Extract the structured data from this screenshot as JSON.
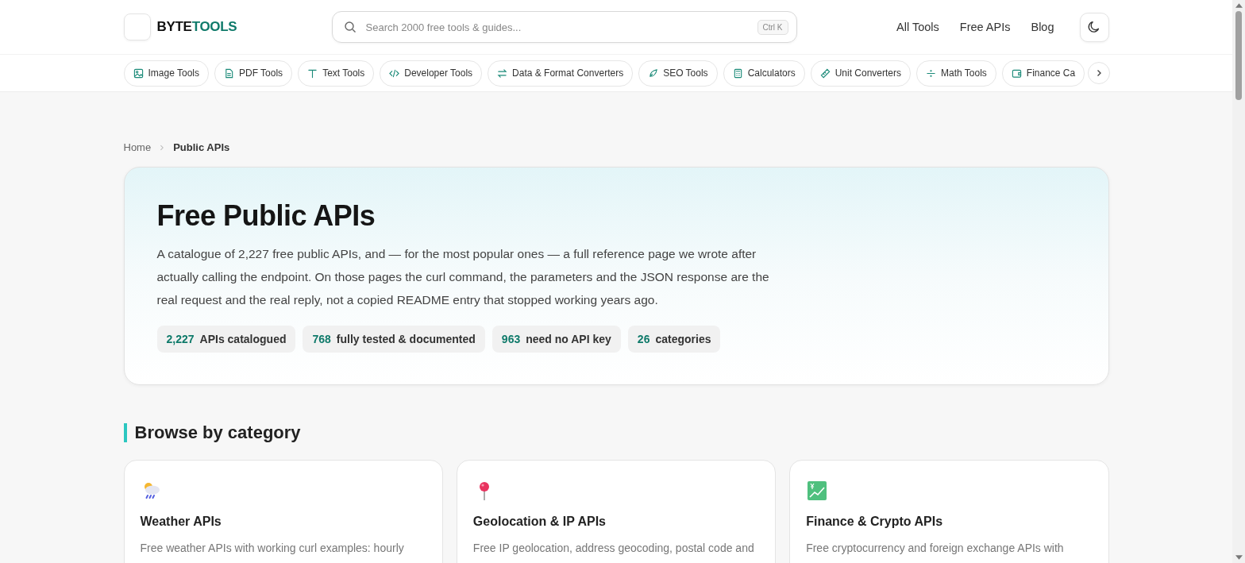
{
  "header": {
    "logo": {
      "first": "BYTE",
      "second": "TOOLS"
    },
    "search": {
      "placeholder": "Search 2000 free tools & guides...",
      "shortcut": "Ctrl K"
    },
    "nav": [
      "All Tools",
      "Free APIs",
      "Blog"
    ]
  },
  "categories": [
    {
      "label": "Image Tools"
    },
    {
      "label": "PDF Tools"
    },
    {
      "label": "Text Tools"
    },
    {
      "label": "Developer Tools"
    },
    {
      "label": "Data & Format Converters"
    },
    {
      "label": "SEO Tools"
    },
    {
      "label": "Calculators"
    },
    {
      "label": "Unit Converters"
    },
    {
      "label": "Math Tools"
    },
    {
      "label": "Finance Ca"
    }
  ],
  "breadcrumb": [
    "Home",
    "Public APIs"
  ],
  "hero": {
    "title": "Free Public APIs",
    "description": "A catalogue of 2,227 free public APIs, and — for the most popular ones — a full reference page we wrote after actually calling the endpoint. On those pages the curl command, the parameters and the JSON response are the real request and the real reply, not a copied README entry that stopped working years ago.",
    "stats": [
      {
        "value": "2,227",
        "label": "APIs catalogued"
      },
      {
        "value": "768",
        "label": "fully tested & documented"
      },
      {
        "value": "963",
        "label": "need no API key"
      },
      {
        "value": "26",
        "label": "categories"
      }
    ]
  },
  "section": {
    "title": "Browse by category",
    "cards": [
      {
        "title": "Weather APIs",
        "description": "Free weather APIs with working curl examples: hourly"
      },
      {
        "title": "Geolocation & IP APIs",
        "description": "Free IP geolocation, address geocoding, postal code and"
      },
      {
        "title": "Finance & Crypto APIs",
        "description": "Free cryptocurrency and foreign exchange APIs with"
      }
    ]
  }
}
